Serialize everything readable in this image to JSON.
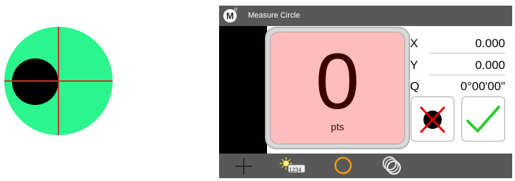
{
  "app": {
    "logo_letter": "M",
    "logo_mark": "®",
    "title": "Measure Circle"
  },
  "counter": {
    "value": "0",
    "unit": "pts"
  },
  "readouts": [
    {
      "label": "X",
      "value": "0.000"
    },
    {
      "label": "Y",
      "value": "0.000"
    },
    {
      "label": "Q",
      "value": "0°00'00\""
    }
  ],
  "toolbar": {
    "counter_badge": "1234"
  },
  "colors": {
    "probe_disc": "#2df58d",
    "crosshair": "#c0392b",
    "counter_bg": "#ffbcbc",
    "accept_check": "#2ecc2e",
    "reject_cross": "#e00000",
    "circle_tool": "#f39c12",
    "bar": "#585858"
  },
  "icons": {
    "reject": "reject-point-icon",
    "accept": "accept-icon",
    "add": "crosshair-add-icon",
    "light": "light-counter-icon",
    "circle": "circle-tool-icon",
    "multi": "multi-circle-icon"
  }
}
